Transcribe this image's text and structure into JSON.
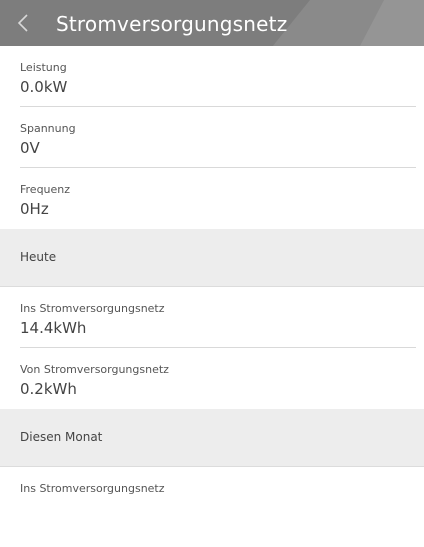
{
  "header": {
    "title": "Stromversorgungsnetz",
    "back_icon": "chevron-left-icon"
  },
  "live": [
    {
      "label": "Leistung",
      "value": "0.0kW"
    },
    {
      "label": "Spannung",
      "value": "0V"
    },
    {
      "label": "Frequenz",
      "value": "0Hz"
    }
  ],
  "today": {
    "heading": "Heute",
    "items": [
      {
        "label": "Ins Stromversorgungsnetz",
        "value": "14.4kWh"
      },
      {
        "label": "Von Stromversorgungsnetz",
        "value": "0.2kWh"
      }
    ]
  },
  "month": {
    "heading": "Diesen Monat",
    "items": [
      {
        "label": "Ins Stromversorgungsnetz",
        "value": ""
      }
    ]
  }
}
